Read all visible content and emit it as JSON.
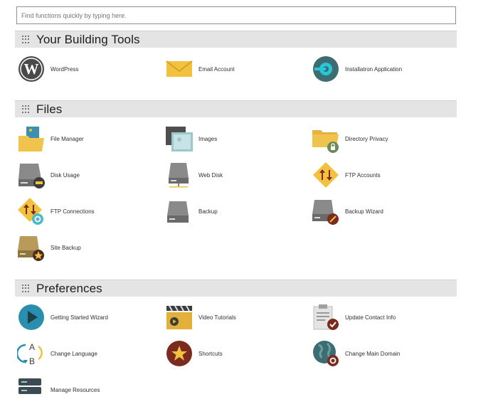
{
  "search": {
    "placeholder": "Find functions quickly by typing here."
  },
  "sections": {
    "building_tools": {
      "title": "Your Building Tools",
      "items": [
        {
          "label": "WordPress",
          "icon": "wordpress-icon"
        },
        {
          "label": "Email Account",
          "icon": "envelope-icon"
        },
        {
          "label": "Installatron Application",
          "icon": "installatron-icon"
        }
      ]
    },
    "files": {
      "title": "Files",
      "items": [
        {
          "label": "File Manager",
          "icon": "folder-image-icon"
        },
        {
          "label": "Images",
          "icon": "images-icon"
        },
        {
          "label": "Directory Privacy",
          "icon": "folder-lock-icon"
        },
        {
          "label": "Disk Usage",
          "icon": "disk-usage-icon"
        },
        {
          "label": "Web Disk",
          "icon": "web-disk-icon"
        },
        {
          "label": "FTP Accounts",
          "icon": "ftp-accounts-icon"
        },
        {
          "label": "FTP Connections",
          "icon": "ftp-connections-icon"
        },
        {
          "label": "Backup",
          "icon": "backup-drive-icon"
        },
        {
          "label": "Backup Wizard",
          "icon": "backup-wizard-icon"
        },
        {
          "label": "Site Backup",
          "icon": "site-backup-icon"
        }
      ]
    },
    "preferences": {
      "title": "Preferences",
      "items": [
        {
          "label": "Getting Started Wizard",
          "icon": "play-icon"
        },
        {
          "label": "Video Tutorials",
          "icon": "clapperboard-icon"
        },
        {
          "label": "Update Contact Info",
          "icon": "clipboard-check-icon"
        },
        {
          "label": "Change Language",
          "icon": "language-icon"
        },
        {
          "label": "Shortcuts",
          "icon": "star-icon"
        },
        {
          "label": "Change Main Domain",
          "icon": "globe-icon"
        },
        {
          "label": "Manage Resources",
          "icon": "server-icon"
        }
      ]
    }
  }
}
